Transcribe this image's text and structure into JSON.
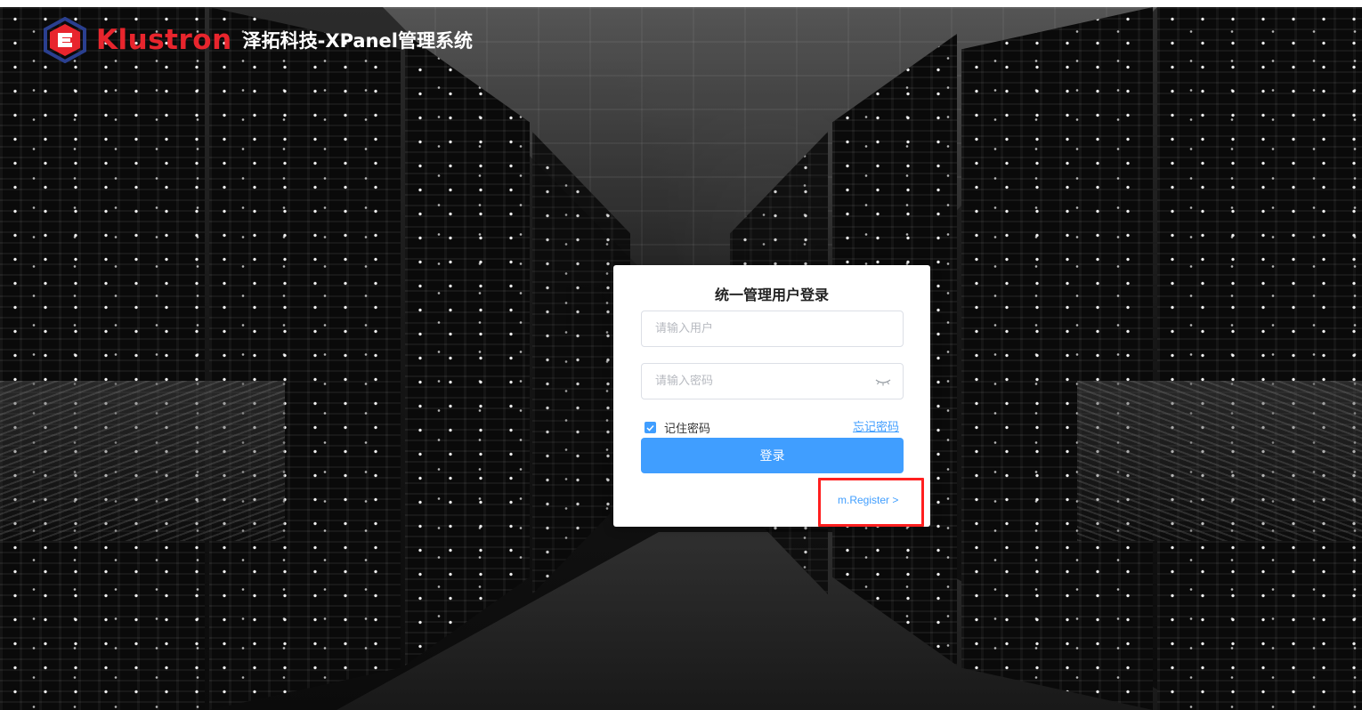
{
  "header": {
    "logo_text": "Klustron",
    "system_title": "泽拓科技-XPanel管理系统"
  },
  "login": {
    "title": "统一管理用户登录",
    "username_placeholder": "请输入用户",
    "password_placeholder": "请输入密码",
    "remember_label": "记住密码",
    "remember_checked": true,
    "forgot_label": "忘记密码",
    "submit_label": "登录",
    "register_label": "m.Register >"
  },
  "colors": {
    "brand_red": "#e8252d",
    "primary_blue": "#409eff",
    "highlight_red": "#ff1f1f"
  },
  "icons": {
    "logo": "klustron-logo-icon",
    "password_toggle": "eye-closed-icon",
    "checkbox": "checkmark-icon"
  }
}
